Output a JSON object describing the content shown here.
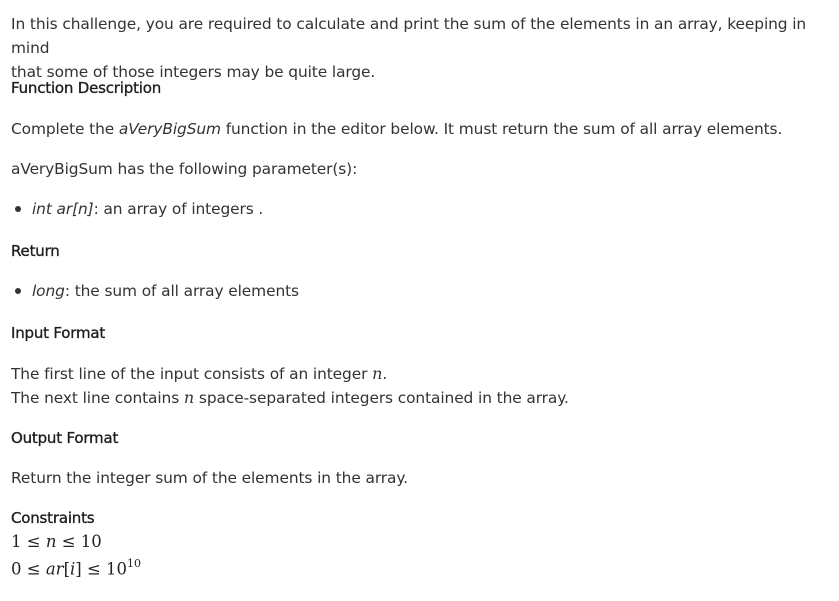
{
  "intro": {
    "line1": "In this challenge, you are required to calculate and print the sum of the elements in an array, keeping in mind",
    "line2": "that some of those integers may be quite large."
  },
  "function_description": {
    "heading": "Function Description",
    "text_pre": "Complete the ",
    "function_name": "aVeryBigSum",
    "text_post": " function in the editor below. It must return the sum of all array elements.",
    "params_intro": "aVeryBigSum has the following parameter(s):",
    "param_type": "int ar[n]",
    "param_desc": ": an array of integers ."
  },
  "return": {
    "heading": "Return",
    "type": "long",
    "desc": ": the sum of all array elements"
  },
  "input_format": {
    "heading": "Input Format",
    "line1_pre": "The first line of the input consists of an integer ",
    "line1_var": "n",
    "line1_post": ".",
    "line2_pre": "The next line contains ",
    "line2_var": "n",
    "line2_post": " space-separated integers contained in the array."
  },
  "output_format": {
    "heading": "Output Format",
    "text": "Return the integer sum of the elements in the array."
  },
  "constraints": {
    "heading": "Constraints",
    "c1_left": "1 ≤ ",
    "c1_var": "n",
    "c1_right": " ≤ 10",
    "c2_left": "0 ≤ ",
    "c2_var": "ar",
    "c2_idx_open": "[",
    "c2_idx_var": "i",
    "c2_idx_close": "]",
    "c2_right": " ≤ 10",
    "c2_exp": "10"
  }
}
